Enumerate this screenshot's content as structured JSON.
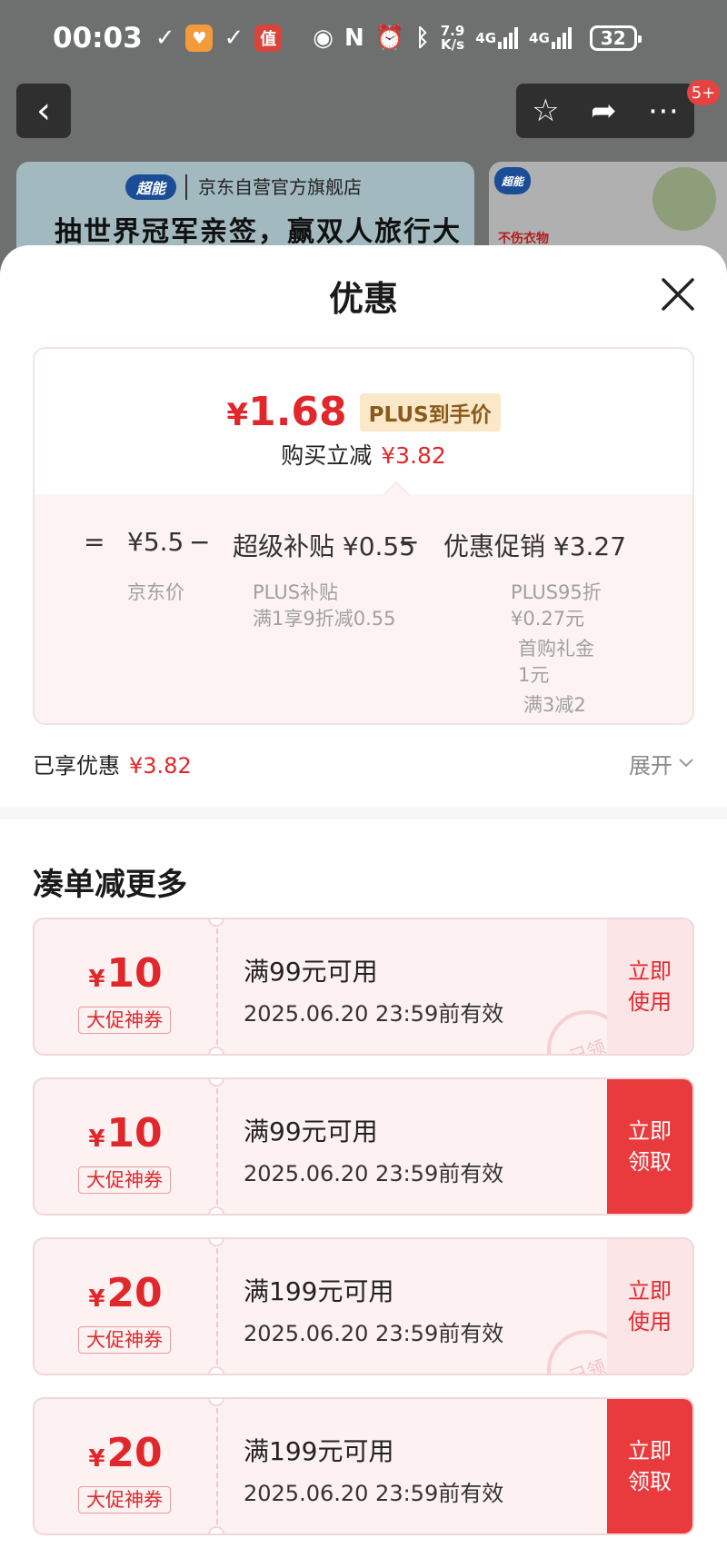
{
  "status_bar": {
    "time": "00:03",
    "speed_top": "7.9",
    "speed_bottom": "K/s",
    "net1": "4G",
    "net2": "4G",
    "battery": "32"
  },
  "nav": {
    "badge": "5+"
  },
  "banner": {
    "logo": "超能",
    "store": "京东自营官方旗舰店",
    "slogan": "抽世界冠军亲签，赢双人旅行大奖",
    "side_logo": "超能",
    "side_text": "不伤衣物"
  },
  "sheet": {
    "title": "优惠",
    "price": {
      "currency": "¥",
      "amount": "1.68",
      "tag": "PLUS到手价",
      "reduce_label": "购买立减",
      "reduce_value": "¥3.82"
    },
    "formula": {
      "equals": "=",
      "base_value": "¥5.5",
      "minus1": "−",
      "subsidy": "超级补贴 ¥0.55",
      "minus2": "−",
      "promo": "优惠促销 ¥3.27",
      "base_label": "京东价",
      "subsidy_line1": "PLUS补贴",
      "subsidy_line2": "满1享9折减0.55",
      "promo_1a": "PLUS95折",
      "promo_1b": "¥0.27元",
      "promo_2a": "首购礼金",
      "promo_2b": "1元",
      "promo_3": "满3减2"
    },
    "saved": {
      "label": "已享优惠",
      "value": "¥3.82",
      "expand": "展开"
    },
    "section_title": "凑单减更多",
    "coupons": [
      {
        "currency": "¥",
        "amount": "10",
        "type": "大促神券",
        "condition": "满99元可用",
        "valid": "2025.06.20 23:59前有效",
        "btn_line1": "立即",
        "btn_line2": "使用",
        "state": "use",
        "stamp": "已领"
      },
      {
        "currency": "¥",
        "amount": "10",
        "type": "大促神券",
        "condition": "满99元可用",
        "valid": "2025.06.20 23:59前有效",
        "btn_line1": "立即",
        "btn_line2": "领取",
        "state": "claim"
      },
      {
        "currency": "¥",
        "amount": "20",
        "type": "大促神券",
        "condition": "满199元可用",
        "valid": "2025.06.20 23:59前有效",
        "btn_line1": "立即",
        "btn_line2": "使用",
        "state": "use",
        "stamp": "已领"
      },
      {
        "currency": "¥",
        "amount": "20",
        "type": "大促神券",
        "condition": "满199元可用",
        "valid": "2025.06.20 23:59前有效",
        "btn_line1": "立即",
        "btn_line2": "领取",
        "state": "claim"
      }
    ]
  },
  "colors": {
    "accent_red": "#e0282c",
    "claim_red": "#e93a3d",
    "plus_gold": "#fbe8c9"
  }
}
